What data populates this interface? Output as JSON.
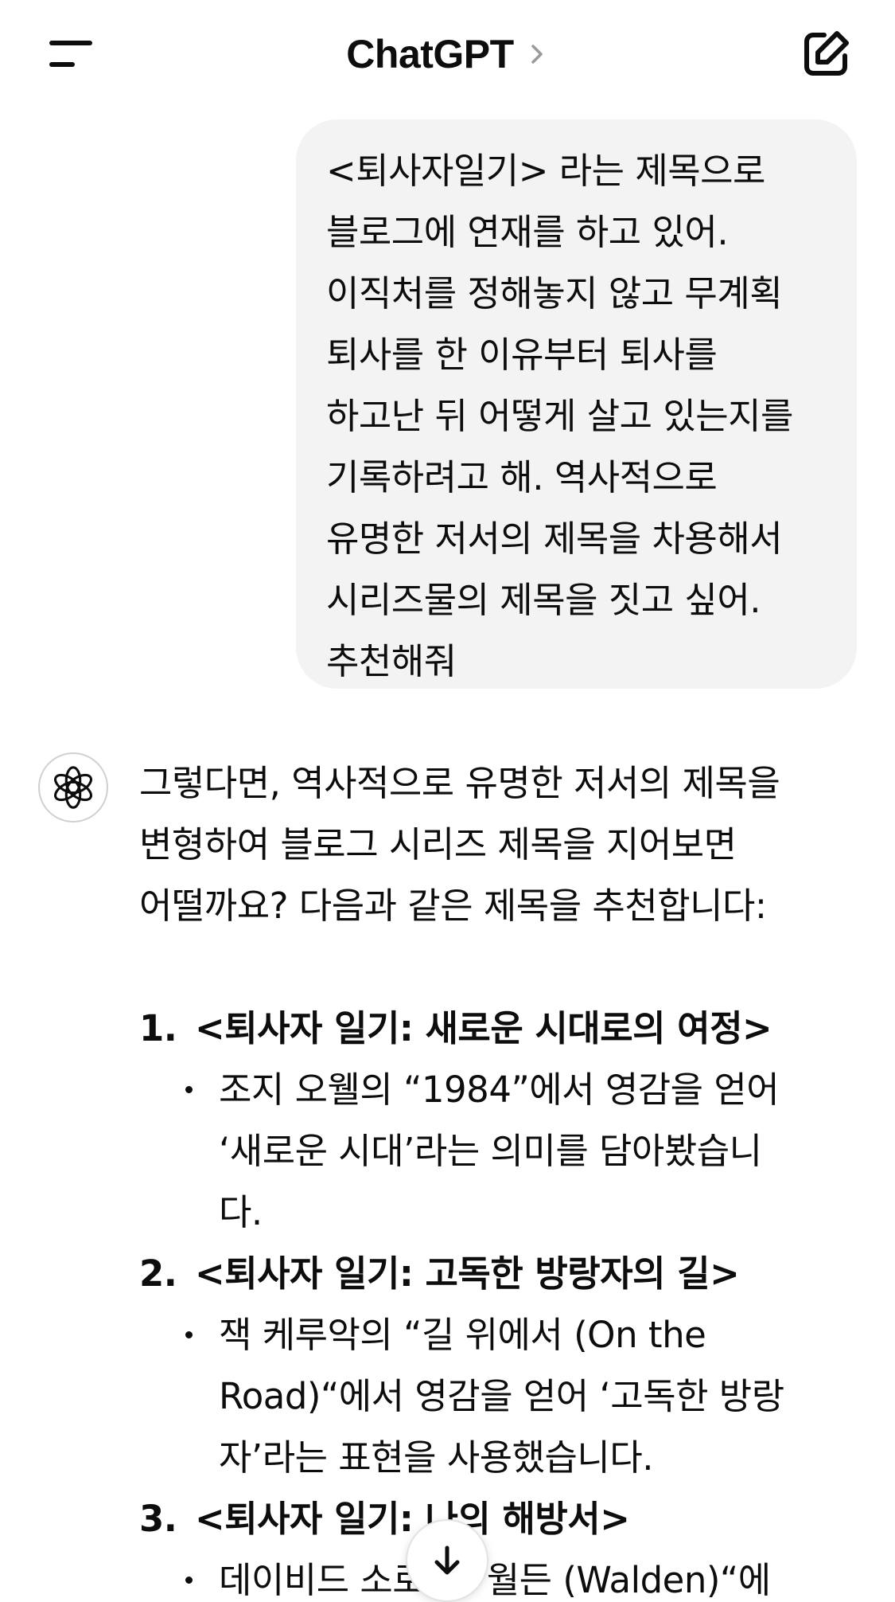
{
  "header": {
    "title": "ChatGPT"
  },
  "user_message": {
    "lines": [
      "<퇴사자일기> 라는 제목으로",
      "블로그에 연재를 하고 있어.",
      "이직처를 정해놓지 않고 무계획",
      "퇴사를 한 이유부터 퇴사를",
      "하고난 뒤 어떻게 살고 있는지를",
      "기록하려고 해. 역사적으로",
      "유명한 저서의 제목을 차용해서",
      "시리즈물의 제목을 짓고 싶어.",
      "추천해줘"
    ]
  },
  "assistant": {
    "intro_lines": [
      "그렇다면, 역사적으로 유명한 저서의 제목을",
      "변형하여 블로그 시리즈 제목을 지어보면",
      "어떨까요? 다음과 같은 제목을 추천합니다:"
    ],
    "items": [
      {
        "number": "1.",
        "title": "<퇴사자 일기: 새로운 시대로의 여정>",
        "bullet_lines": [
          "조지 오웰의 “1984”에서 영감을 얻어",
          "‘새로운 시대’라는 의미를 담아봤습니",
          "다."
        ]
      },
      {
        "number": "2.",
        "title": "<퇴사자 일기: 고독한 방랑자의 길>",
        "bullet_lines": [
          "잭 케루악의 “길 위에서 (On the",
          "Road)“에서 영감을 얻어 ‘고독한 방랑",
          "자’라는 표현을 사용했습니다."
        ]
      },
      {
        "number": "3.",
        "title": "<퇴사자 일기: 나의 해방서>",
        "bullet_lines": [
          "데이비드 소로의 “월든 (Walden)“에"
        ]
      }
    ]
  },
  "icons": {
    "menu": "menu-icon",
    "chevron": "chevron-right-icon",
    "new_chat": "new-chat-icon",
    "avatar": "openai-logo-icon",
    "scroll": "arrow-down-icon"
  }
}
